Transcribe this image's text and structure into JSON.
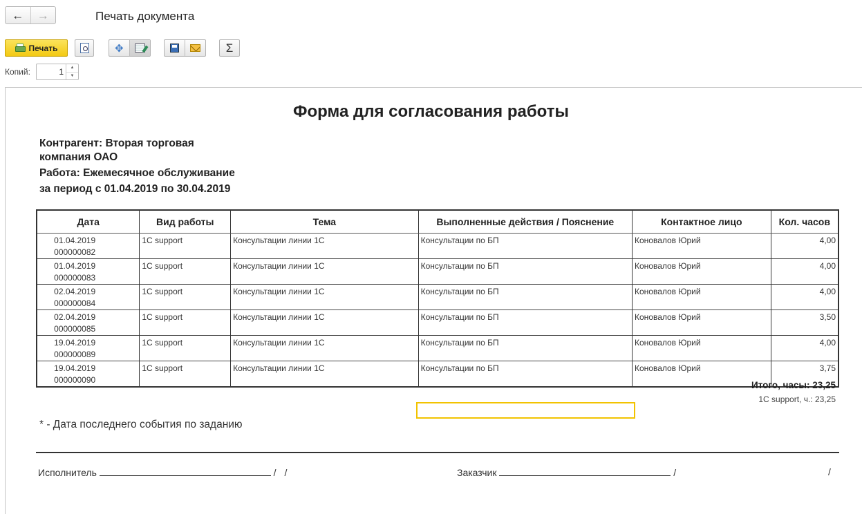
{
  "window": {
    "title": "Печать документа",
    "back_icon": "←",
    "forward_icon": "→"
  },
  "toolbar": {
    "print_label": "Печать",
    "sum_icon": "Σ",
    "move_icon": "✥"
  },
  "copies": {
    "label": "Копий:",
    "value": "1"
  },
  "document": {
    "title": "Форма для согласования работы",
    "counterparty_line1": "Контрагент: Вторая торговая",
    "counterparty_line2": "компания ОАО",
    "work": "Работа: Ежемесячное обслуживание",
    "period": "за период с 01.04.2019 по 30.04.2019",
    "columns": [
      "Дата",
      "Вид работы",
      "Тема",
      "Выполненные действия / Пояснение",
      "Контактное лицо",
      "Кол. часов"
    ],
    "rows": [
      {
        "date": "01.04.2019",
        "number": "000000082",
        "type": "1С support",
        "topic": "Консультации линии 1С",
        "actions": "Консультации по БП",
        "contact": "Коновалов Юрий",
        "hours": "4,00"
      },
      {
        "date": "01.04.2019",
        "number": "000000083",
        "type": "1С support",
        "topic": "Консультации линии 1С",
        "actions": "Консультации по БП",
        "contact": "Коновалов Юрий",
        "hours": "4,00"
      },
      {
        "date": "02.04.2019",
        "number": "000000084",
        "type": "1С support",
        "topic": "Консультации линии 1С",
        "actions": "Консультации по БП",
        "contact": "Коновалов Юрий",
        "hours": "4,00"
      },
      {
        "date": "02.04.2019",
        "number": "000000085",
        "type": "1С support",
        "topic": "Консультации линии 1С",
        "actions": "Консультации по БП",
        "contact": "Коновалов Юрий",
        "hours": "3,50"
      },
      {
        "date": "19.04.2019",
        "number": "000000089",
        "type": "1С support",
        "topic": "Консультации линии 1С",
        "actions": "Консультации по БП",
        "contact": "Коновалов Юрий",
        "hours": "4,00"
      },
      {
        "date": "19.04.2019",
        "number": "000000090",
        "type": "1С support",
        "topic": "Консультации линии 1С",
        "actions": "Консультации по БП",
        "contact": "Коновалов Юрий",
        "hours": "3,75"
      }
    ],
    "total": "Итого, часы: 23,25",
    "subtotal": "1С support, ч.: 23,25",
    "note": "* - Дата последнего события по заданию",
    "executor_label": "Исполнитель",
    "customer_label": "Заказчик",
    "slash": "/"
  }
}
